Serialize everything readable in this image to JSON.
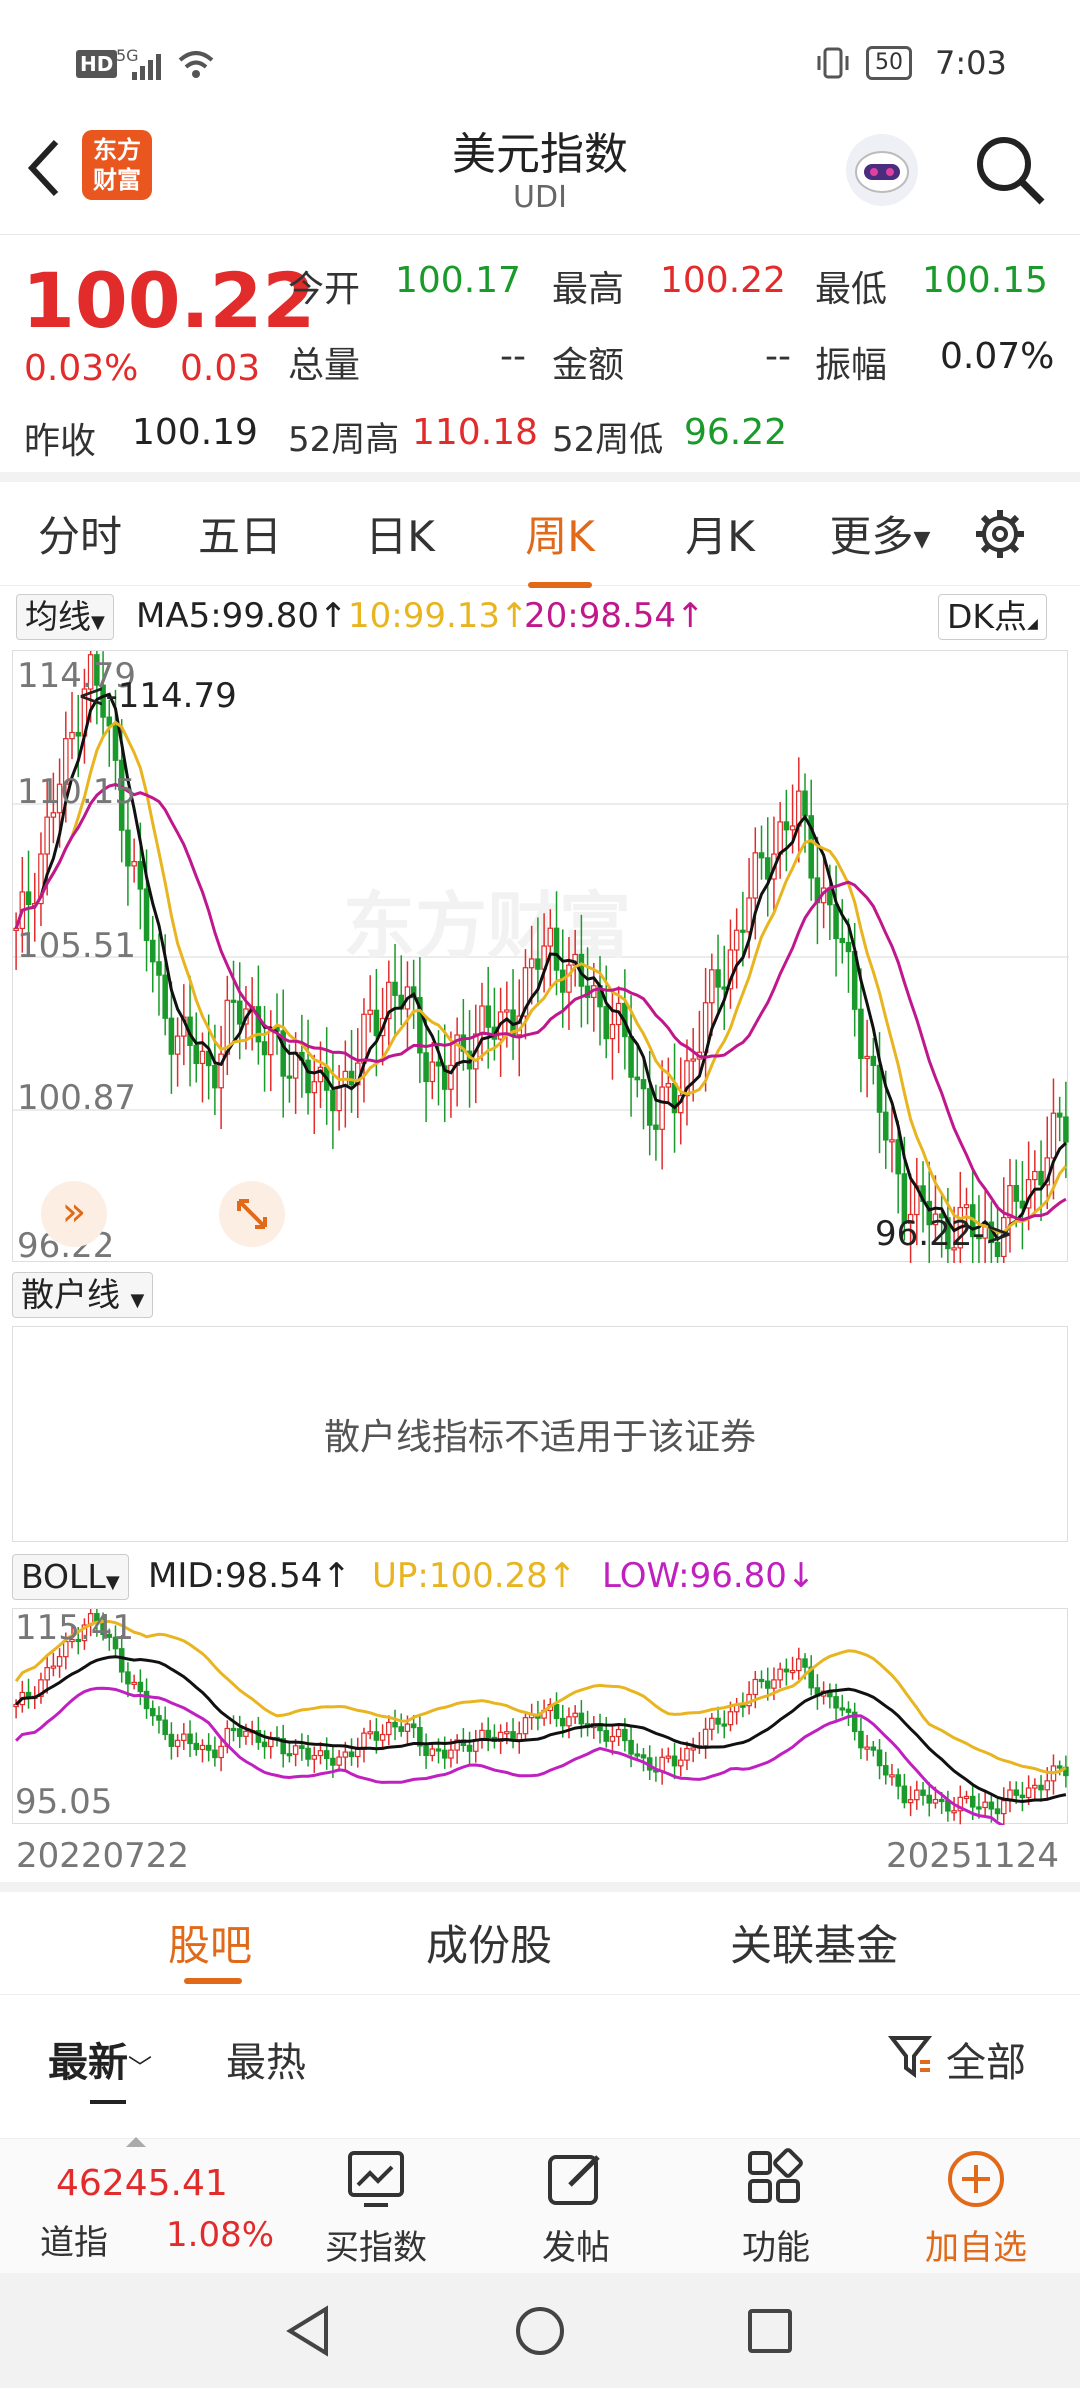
{
  "status": {
    "hd": "HD",
    "net": "5G",
    "battery": "50",
    "time": "7:03"
  },
  "header": {
    "title": "美元指数",
    "code": "UDI",
    "logo_line1": "东方",
    "logo_line2": "财富"
  },
  "quote": {
    "price": "100.22",
    "change_pct": "0.03%",
    "change": "0.03",
    "open_label": "今开",
    "open": "100.17",
    "high_label": "最高",
    "high": "100.22",
    "low_label": "最低",
    "low": "100.15",
    "volume_label": "总量",
    "volume": "--",
    "amount_label": "金额",
    "amount": "--",
    "amplitude_label": "振幅",
    "amplitude": "0.07%",
    "prev_label": "昨收",
    "prev": "100.19",
    "w52h_label": "52周高",
    "w52h": "110.18",
    "w52l_label": "52周低",
    "w52l": "96.22"
  },
  "tabs": [
    "分时",
    "五日",
    "日K",
    "周K",
    "月K",
    "更多"
  ],
  "active_tab": "周K",
  "ma": {
    "selector": "均线",
    "ma5": "MA5:99.80",
    "ma10": "10:99.13",
    "ma20": "20:98.54",
    "dk": "DK点"
  },
  "kline": {
    "y_max": "114.79",
    "y_2": "110.15",
    "y_3": "105.51",
    "y_4": "100.87",
    "y_min": "96.22",
    "hi_marker": "<-114.79",
    "lo_marker": "96.22->"
  },
  "retail": {
    "selector": "散户线",
    "message": "散户线指标不适用于该证券"
  },
  "boll": {
    "selector": "BOLL",
    "mid": "MID:98.54",
    "up": "UP:100.28",
    "low": "LOW:96.80",
    "y_max": "115.41",
    "y_min": "95.05",
    "date_start": "20220722",
    "date_end": "20251124"
  },
  "subtabs": [
    "股吧",
    "成份股",
    "关联基金"
  ],
  "filter": {
    "latest": "最新",
    "hot": "最热",
    "all": "全部"
  },
  "bottom": {
    "index_value": "46245.41",
    "index_name": "道指",
    "index_pct": "1.08%",
    "buy": "买指数",
    "post": "发帖",
    "func": "功能",
    "add": "加自选"
  },
  "colors": {
    "up": "#e22b2b",
    "down": "#1a9a2a",
    "accent": "#e06a1a",
    "ma10": "#e8b520",
    "ma20": "#c0178c",
    "low_band": "#c020c0"
  },
  "chart_data": {
    "type": "candlestick",
    "title": "美元指数 周K",
    "x_start": "20220722",
    "x_end": "20251124",
    "ylim": [
      96.22,
      114.79
    ],
    "series": [
      {
        "name": "MA5",
        "last": 99.8
      },
      {
        "name": "MA10",
        "last": 99.13
      },
      {
        "name": "MA20",
        "last": 98.54
      }
    ],
    "boll": {
      "mid": 98.54,
      "up": 100.28,
      "low": 96.8,
      "ylim": [
        95.05,
        115.41
      ]
    },
    "close_path": [
      106,
      108,
      110,
      112,
      114.79,
      113,
      110,
      107,
      104.5,
      103,
      102.5,
      102,
      103.5,
      104,
      103,
      102,
      102.5,
      101,
      101.5,
      102,
      103.5,
      104.5,
      104,
      102.5,
      101.5,
      102.5,
      103.5,
      103,
      104,
      105,
      106,
      105,
      104.5,
      104,
      103,
      101.5,
      100.5,
      101,
      102.5,
      104,
      105.5,
      107,
      108.5,
      109.5,
      110,
      108,
      106.5,
      104.5,
      102,
      99.5,
      98,
      97.5,
      97,
      97.2,
      96.8,
      96.9,
      97.5,
      98.5,
      99.5,
      100.2
    ]
  }
}
